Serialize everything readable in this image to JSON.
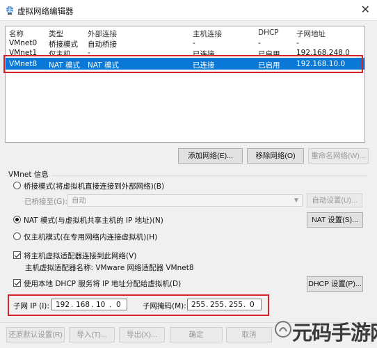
{
  "window": {
    "title": "虚拟网络编辑器",
    "close_glyph": "✕"
  },
  "table": {
    "columns": [
      "名称",
      "类型",
      "外部连接",
      "主机连接",
      "DHCP",
      "子网地址"
    ],
    "rows": [
      [
        "VMnet0",
        "桥接模式",
        "自动桥接",
        "-",
        "-",
        "-"
      ],
      [
        "VMnet1",
        "仅主机...",
        "-",
        "已连接",
        "已启用",
        "192.168.248.0"
      ],
      [
        "VMnet8",
        "NAT 模式",
        "NAT 模式",
        "已连接",
        "已启用",
        "192.168.10.0"
      ]
    ],
    "selected_row": 2
  },
  "buttons": {
    "add": "添加网络(E)...",
    "remove": "移除网络(O)",
    "rename": "重命名网络(W)..."
  },
  "vmnet_info": {
    "label": "VMnet 信息",
    "bridge_mode": "桥接模式(将虚拟机直接连接到外部网络)(B)",
    "bridge_to_label": "已桥接至(G):",
    "bridge_to_value": "自动",
    "auto_settings": "自动设置(U)...",
    "nat_mode": "NAT 模式(与虚拟机共享主机的 IP 地址)(N)",
    "nat_settings": "NAT 设置(S)...",
    "host_only": "仅主机模式(在专用网络内连接虚拟机)(H)",
    "connect_adapter": "将主机虚拟适配器连接到此网络(V)",
    "adapter_name": "主机虚拟适配器名称: VMware 网络适配器 VMnet8",
    "use_dhcp": "使用本地 DHCP 服务将 IP 地址分配给虚拟机(D)",
    "dhcp_settings": "DHCP 设置(P)...",
    "subnet_ip_label": "子网 IP (I):",
    "subnet_ip": [
      "192",
      "168",
      "10",
      "0"
    ],
    "subnet_mask_label": "子网掩码(M):",
    "subnet_mask": [
      "255",
      "255",
      "255",
      "0"
    ]
  },
  "footer": {
    "restore": "还原默认设置(R)",
    "import": "导入(T)...",
    "export": "导出(X)...",
    "ok": "确定",
    "cancel": "取消"
  },
  "watermark": {
    "text": "元码手游网"
  },
  "colors": {
    "selection": "#0a78d7",
    "highlight_box": "#d8232a"
  },
  "icons": {
    "app": "network-globe-icon",
    "close": "close-icon",
    "dropdown": "chevron-down-icon"
  }
}
